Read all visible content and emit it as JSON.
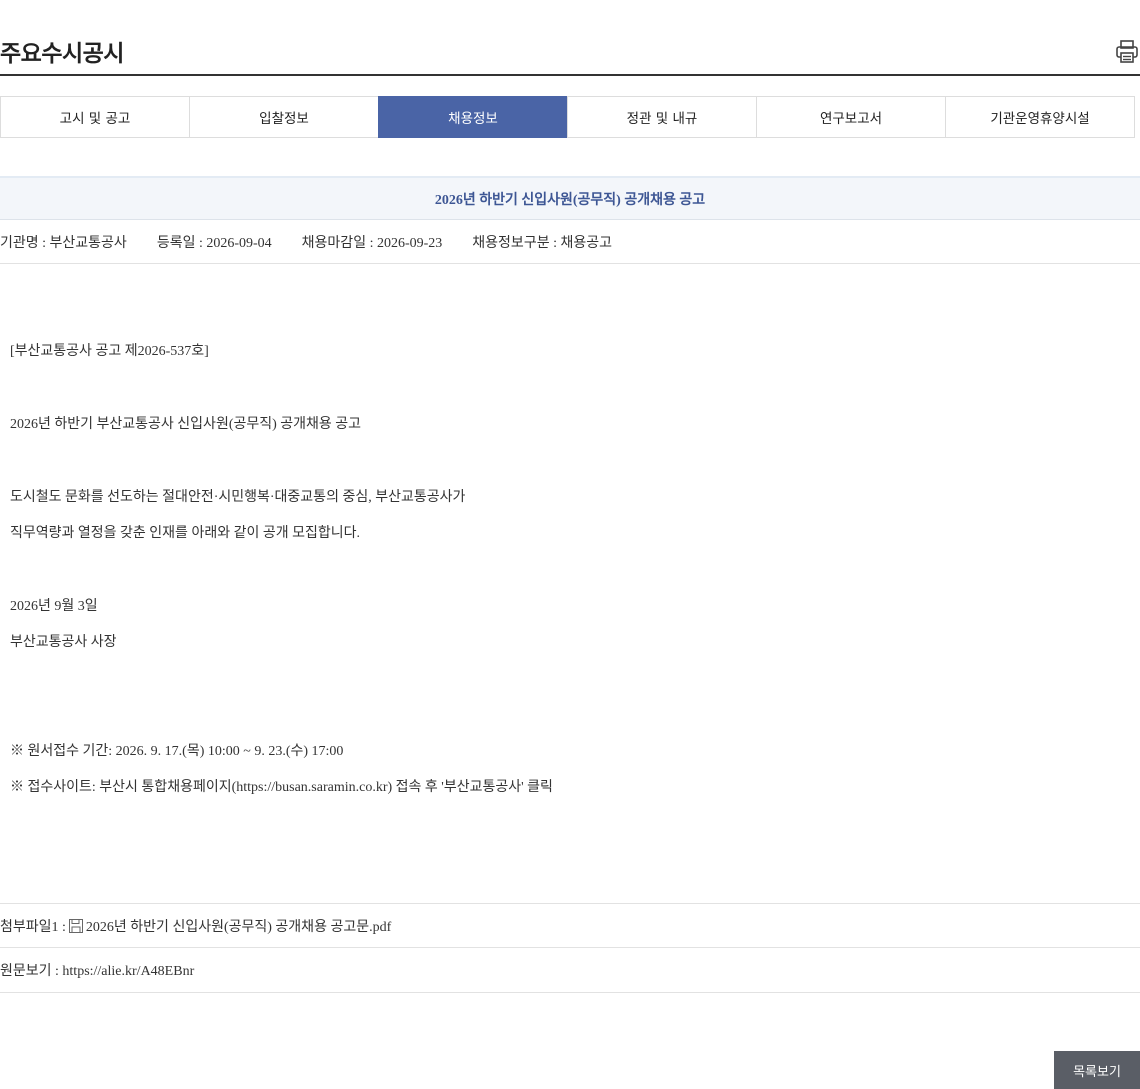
{
  "header": {
    "title": "주요수시공시",
    "print_icon": "printer-icon"
  },
  "tabs": [
    {
      "label": "고시 및 공고",
      "active": false
    },
    {
      "label": "입찰정보",
      "active": false
    },
    {
      "label": "채용정보",
      "active": true
    },
    {
      "label": "정관 및 내규",
      "active": false
    },
    {
      "label": "연구보고서",
      "active": false
    },
    {
      "label": "기관운영휴양시설",
      "active": false
    }
  ],
  "post": {
    "title": "2026년 하반기 신입사원(공무직) 공개채용 공고",
    "meta": {
      "agency": "기관명 : 부산교통공사",
      "registered": "등록일 : 2026-09-04",
      "deadline": "채용마감일 : 2026-09-23",
      "category": "채용정보구분 : 채용공고"
    },
    "body": [
      "[부산교통공사 공고 제2026-537호]",
      "2026년 하반기 부산교통공사 신입사원(공무직) 공개채용 공고",
      "도시철도 문화를 선도하는 절대안전·시민행복·대중교통의 중심, 부산교통공사가",
      "직무역량과 열정을 갖춘 인재를 아래와 같이 공개 모집합니다.",
      "2026년 9월 3일",
      "부산교통공사 사장",
      "※ 원서접수 기간: 2026. 9. 17.(목) 10:00 ~ 9. 23.(수) 17:00",
      "※ 접수사이트: 부산시 통합채용페이지(https://busan.saramin.co.kr) 접속 후 '부산교통공사' 클릭"
    ],
    "attachment": {
      "label": "첨부파일1 :",
      "filename": "2026년 하반기 신입사원(공무직) 공개채용 공고문.pdf",
      "icon": "file-icon"
    },
    "original": {
      "text": "원문보기 : https://alie.kr/A48EBnr"
    }
  },
  "actions": {
    "list_label": "목록보기"
  },
  "colors": {
    "accent": "#4a64a6",
    "title_text": "#3d5694",
    "button_bg": "#5a5e66"
  }
}
